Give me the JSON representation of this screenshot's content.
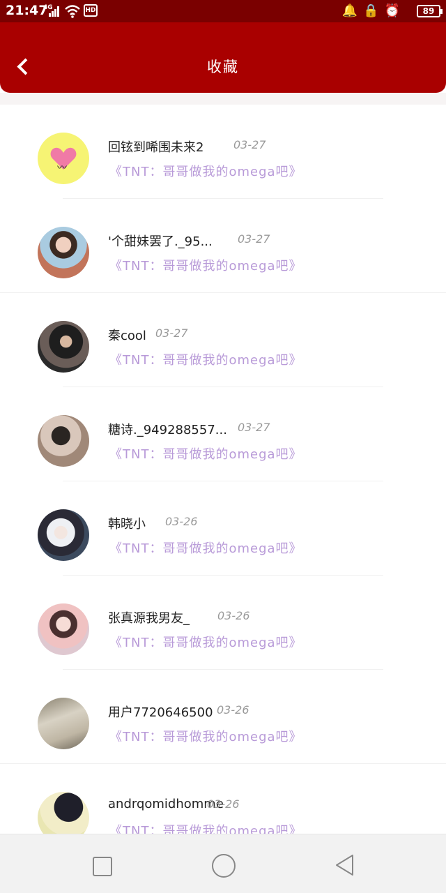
{
  "status_bar": {
    "time": "21:47",
    "network": "4G",
    "hd": "HD",
    "battery": "89"
  },
  "header": {
    "title": "收藏"
  },
  "favorites": [
    {
      "user": "回铉到唏围未来2",
      "date": "03-27",
      "book": "《TNT：哥哥做我的omega吧》",
      "avatar": "heart-mustache"
    },
    {
      "user": "'个甜妹罢了._95...",
      "date": "03-27",
      "book": "《TNT：哥哥做我的omega吧》",
      "avatar": "photo"
    },
    {
      "user": "秦cool",
      "date": "03-27",
      "book": "《TNT：哥哥做我的omega吧》",
      "avatar": "photo"
    },
    {
      "user": "糖诗._949288557...",
      "date": "03-27",
      "book": "《TNT：哥哥做我的omega吧》",
      "avatar": "photo"
    },
    {
      "user": "韩晓小",
      "date": "03-26",
      "book": "《TNT：哥哥做我的omega吧》",
      "avatar": "photo"
    },
    {
      "user": "张真源我男友_",
      "date": "03-26",
      "book": "《TNT：哥哥做我的omega吧》",
      "avatar": "photo"
    },
    {
      "user": "用户7720646500",
      "date": "03-26",
      "book": "《TNT：哥哥做我的omega吧》",
      "avatar": "photo"
    },
    {
      "user": "andrqomidhomme",
      "date": "03-26",
      "book": "《TNT：哥哥做我的omega吧》",
      "avatar": "photo"
    }
  ],
  "nav_bar": {
    "buttons": [
      "square-icon",
      "circle-icon",
      "back-triangle-icon"
    ]
  },
  "colors": {
    "header": "#a90000",
    "status_bar": "#7a0000",
    "book_title": "#b89ad8",
    "date": "#9a9a9a"
  }
}
